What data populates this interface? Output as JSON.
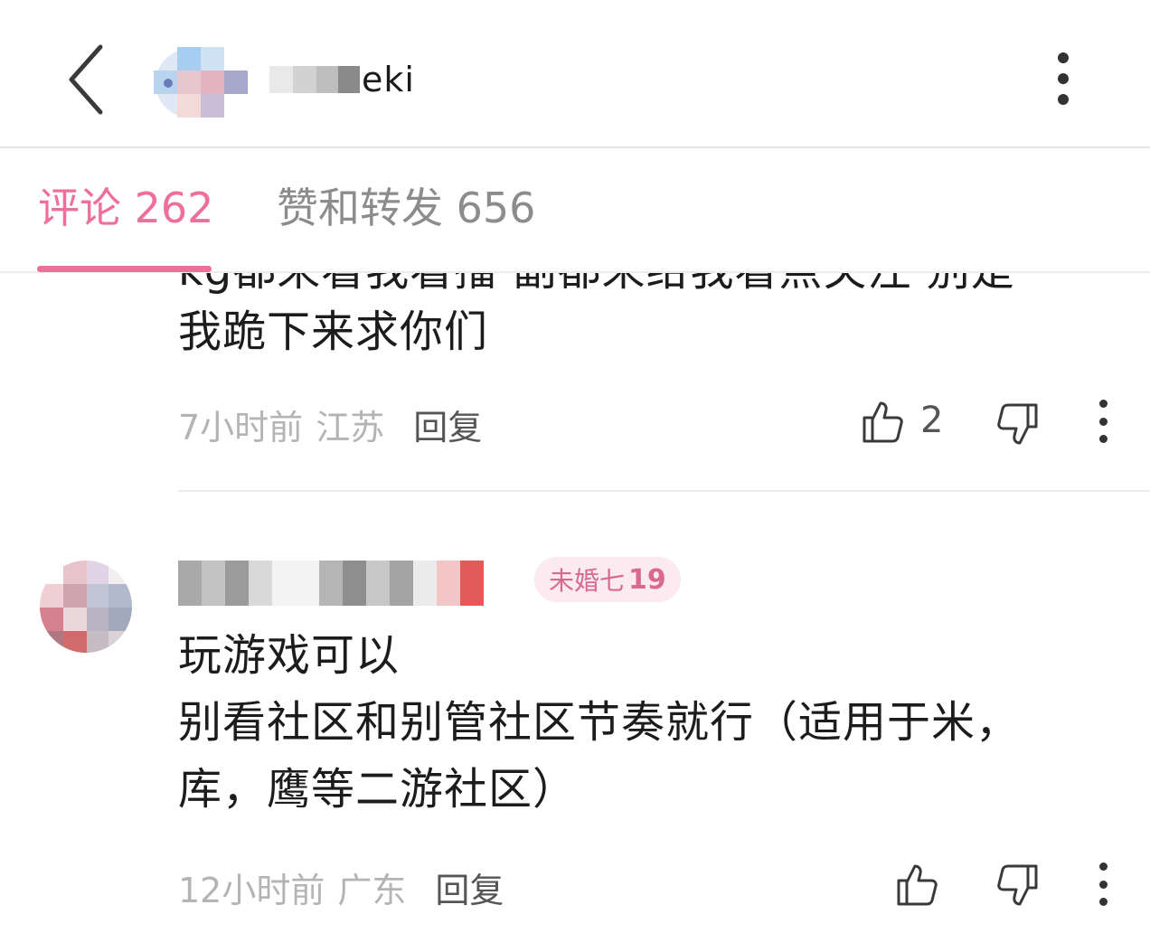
{
  "header": {
    "back_icon": "chevron-left-icon",
    "username_visible": "eki",
    "more_icon": "vertical-dots-icon"
  },
  "tabs": [
    {
      "label": "评论 262",
      "active": true
    },
    {
      "label": "赞和转发 656",
      "active": false
    }
  ],
  "accent_color": "#ee6f98",
  "comments": [
    {
      "text_cut": "kg都来看我看播·副都来给我看点关注 别是",
      "text": "我跪下来求你们",
      "time": "7小时前",
      "location": "江苏",
      "reply": "回复",
      "likes": "2"
    },
    {
      "badge_text": "未婚七",
      "badge_level": "19",
      "text": "玩游戏可以\n别看社区和别管社区节奏就行（适用于米，\n库，鹰等二游社区）",
      "time": "12小时前",
      "location": "广东",
      "reply": "回复",
      "likes": ""
    }
  ]
}
